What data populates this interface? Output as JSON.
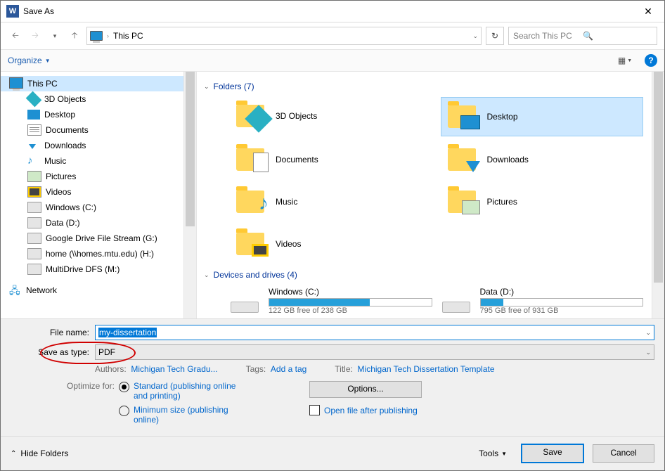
{
  "window": {
    "title": "Save As"
  },
  "address": {
    "location": "This PC"
  },
  "search": {
    "placeholder": "Search This PC"
  },
  "toolbar": {
    "organize": "Organize"
  },
  "tree": {
    "root": "This PC",
    "items": [
      "3D Objects",
      "Desktop",
      "Documents",
      "Downloads",
      "Music",
      "Pictures",
      "Videos",
      "Windows (C:)",
      "Data (D:)",
      "Google Drive File Stream (G:)",
      "home (\\\\homes.mtu.edu) (H:)",
      "MultiDrive DFS (M:)"
    ],
    "network": "Network"
  },
  "pane": {
    "folders_header": "Folders (7)",
    "folders": [
      "3D Objects",
      "Desktop",
      "Documents",
      "Downloads",
      "Music",
      "Pictures",
      "Videos"
    ],
    "selected_index": 1,
    "drives_header": "Devices and drives (4)",
    "drives": [
      {
        "name": "Windows (C:)",
        "fill_pct": 62,
        "free": "122 GB free of 238 GB"
      },
      {
        "name": "Data (D:)",
        "fill_pct": 14,
        "free": "795 GB free of 931 GB"
      }
    ]
  },
  "form": {
    "filename_label": "File name:",
    "filename_value": "my-dissertation",
    "savetype_label": "Save as type:",
    "savetype_value": "PDF",
    "authors_label": "Authors:",
    "authors_value": "Michigan Tech Gradu...",
    "tags_label": "Tags:",
    "tags_value": "Add a tag",
    "title_label": "Title:",
    "title_value": "Michigan Tech Dissertation Template",
    "optimize_label": "Optimize for:",
    "opt_standard": "Standard (publishing online and printing)",
    "opt_minimum": "Minimum size (publishing online)",
    "options_btn": "Options...",
    "open_after": "Open file after publishing"
  },
  "bottom": {
    "hide_folders": "Hide Folders",
    "tools": "Tools",
    "save": "Save",
    "cancel": "Cancel"
  }
}
